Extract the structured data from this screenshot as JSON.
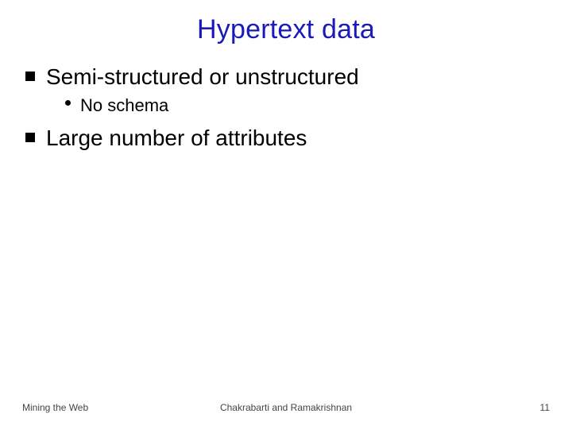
{
  "title": "Hypertext data",
  "bullets": {
    "item0": {
      "text": "Semi-structured or unstructured",
      "sub0": "No schema"
    },
    "item1": {
      "text": "Large number of attributes"
    }
  },
  "footer": {
    "left": "Mining the Web",
    "center": "Chakrabarti and Ramakrishnan",
    "page": "11"
  }
}
